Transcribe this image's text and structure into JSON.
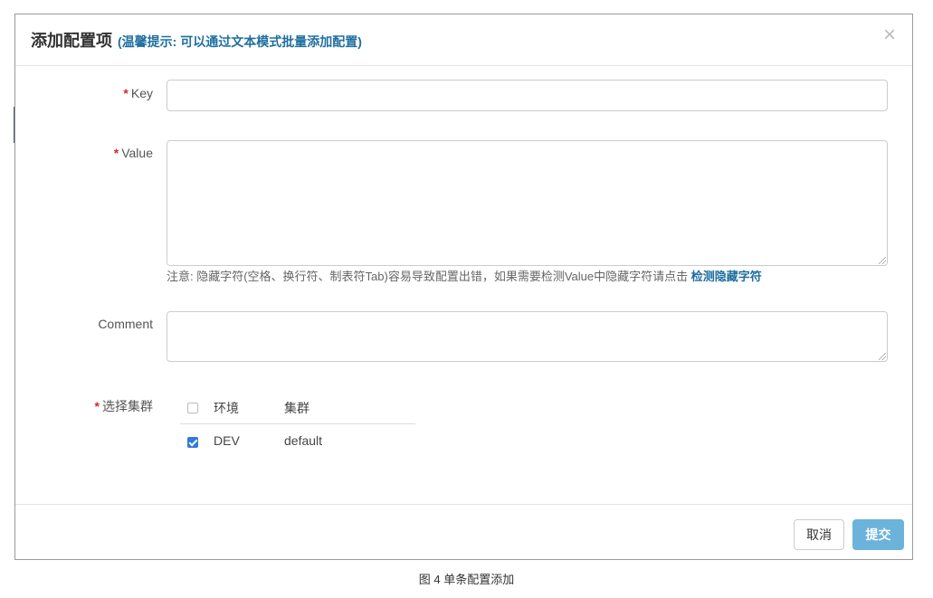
{
  "modal": {
    "title": "添加配置项",
    "tip": "(温馨提示: 可以通过文本模式批量添加配置)",
    "close_icon": "close-icon"
  },
  "form": {
    "required_mark": "*",
    "key_label": "Key",
    "key_value": "",
    "value_label": "Value",
    "value_value": "",
    "value_note": "注意: 隐藏字符(空格、换行符、制表符Tab)容易导致配置出错，如果需要检测Value中隐藏字符请点击",
    "value_note_link": "检测隐藏字符",
    "comment_label": "Comment",
    "comment_value": "",
    "cluster_label": "选择集群"
  },
  "cluster_table": {
    "columns": [
      "环境",
      "集群"
    ],
    "header_checked": false,
    "rows": [
      {
        "env": "DEV",
        "cluster": "default",
        "checked": true
      }
    ]
  },
  "footer": {
    "cancel_label": "取消",
    "submit_label": "提交"
  },
  "caption": "图 4  单条配置添加",
  "colors": {
    "accent": "#1f6fa0",
    "submit": "#6bb3da",
    "required": "#c9302c",
    "checkbox": "#2f7bd9"
  }
}
